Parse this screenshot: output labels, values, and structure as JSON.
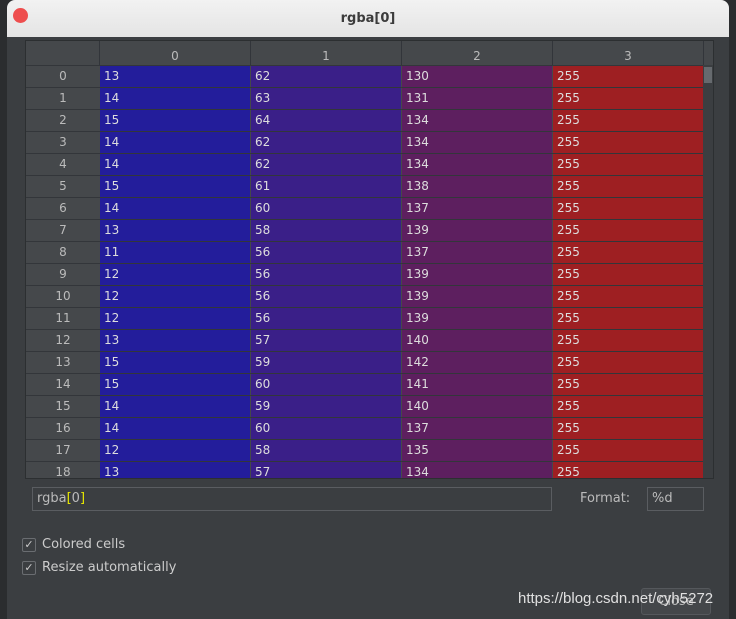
{
  "window": {
    "title": "rgba[0]"
  },
  "table": {
    "columns": [
      "0",
      "1",
      "2",
      "3"
    ],
    "rows": [
      [
        "0",
        [
          "13",
          "62",
          "130",
          "255"
        ]
      ],
      [
        "1",
        [
          "14",
          "63",
          "131",
          "255"
        ]
      ],
      [
        "2",
        [
          "15",
          "64",
          "134",
          "255"
        ]
      ],
      [
        "3",
        [
          "14",
          "62",
          "134",
          "255"
        ]
      ],
      [
        "4",
        [
          "14",
          "62",
          "134",
          "255"
        ]
      ],
      [
        "5",
        [
          "15",
          "61",
          "138",
          "255"
        ]
      ],
      [
        "6",
        [
          "14",
          "60",
          "137",
          "255"
        ]
      ],
      [
        "7",
        [
          "13",
          "58",
          "139",
          "255"
        ]
      ],
      [
        "8",
        [
          "11",
          "56",
          "137",
          "255"
        ]
      ],
      [
        "9",
        [
          "12",
          "56",
          "139",
          "255"
        ]
      ],
      [
        "10",
        [
          "12",
          "56",
          "139",
          "255"
        ]
      ],
      [
        "11",
        [
          "12",
          "56",
          "139",
          "255"
        ]
      ],
      [
        "12",
        [
          "13",
          "57",
          "140",
          "255"
        ]
      ],
      [
        "13",
        [
          "15",
          "59",
          "142",
          "255"
        ]
      ],
      [
        "14",
        [
          "15",
          "60",
          "141",
          "255"
        ]
      ],
      [
        "15",
        [
          "14",
          "59",
          "140",
          "255"
        ]
      ],
      [
        "16",
        [
          "14",
          "60",
          "137",
          "255"
        ]
      ],
      [
        "17",
        [
          "12",
          "58",
          "135",
          "255"
        ]
      ],
      [
        "18",
        [
          "13",
          "57",
          "134",
          "255"
        ]
      ]
    ]
  },
  "expression": {
    "name": "rgba",
    "open": "[",
    "index": "0",
    "close": "]"
  },
  "format": {
    "label": "Format:",
    "value": "%d"
  },
  "options": [
    {
      "label": "Colored cells",
      "checked": true
    },
    {
      "label": "Resize automatically",
      "checked": true
    }
  ],
  "close_label": "Close",
  "watermark": "https://blog.csdn.net/cyh5272",
  "colors": {
    "col0": "#231d9b",
    "col1": "#3a1f88",
    "col2": "#5d1f5f",
    "col3": "#9e1f22"
  }
}
